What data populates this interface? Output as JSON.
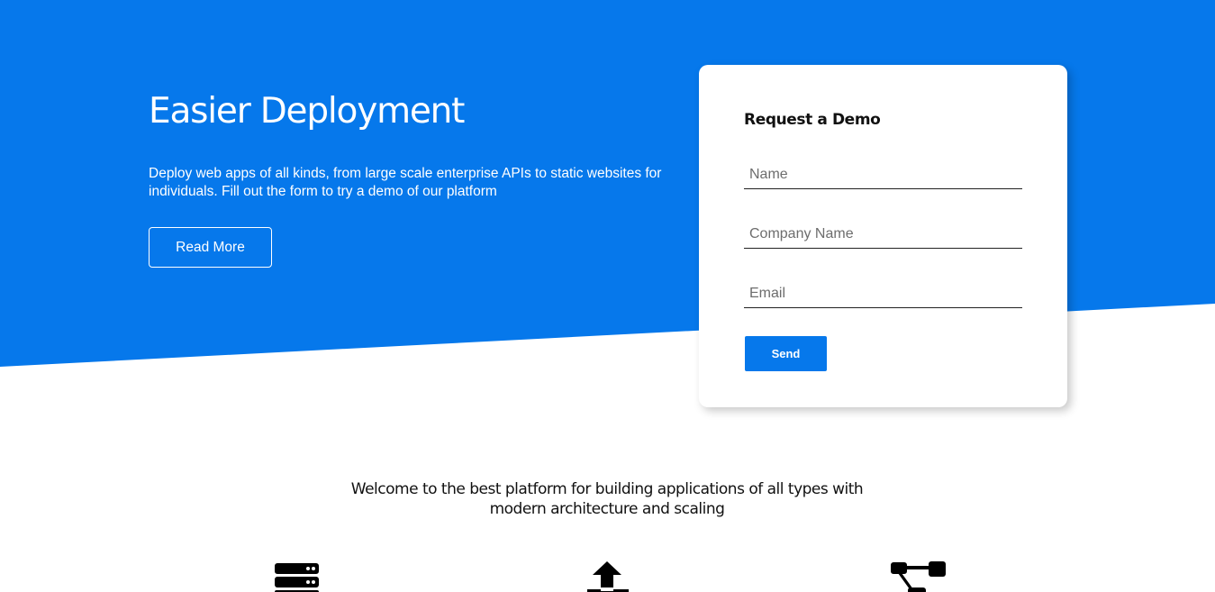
{
  "hero": {
    "title": "Easier Deployment",
    "description": "Deploy web apps of all kinds, from large scale enterprise APIs to static websites for individuals. Fill out the form to try a demo of our platform",
    "read_more_label": "Read More",
    "background_color": "#0678eb"
  },
  "demo_form": {
    "title": "Request a Demo",
    "name_placeholder": "Name",
    "company_placeholder": "Company Name",
    "email_placeholder": "Email",
    "send_label": "Send",
    "accent_color": "#0678eb"
  },
  "welcome": {
    "text": "Welcome to the best platform for building applications of all types with modern architecture and scaling"
  },
  "features": {
    "icons": [
      "server-icon",
      "upload-icon",
      "sitemap-icon"
    ]
  }
}
